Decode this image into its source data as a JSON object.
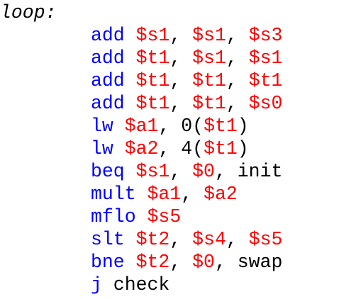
{
  "colors": {
    "mnemonic": "#0000ff",
    "register": "#ff0000",
    "text": "#000000",
    "background": "#ffffff"
  },
  "code": {
    "label": "loop:",
    "instructions": [
      {
        "tokens": [
          {
            "t": "op",
            "v": "add"
          },
          {
            "t": "txt",
            "v": " "
          },
          {
            "t": "reg",
            "v": "$s1"
          },
          {
            "t": "txt",
            "v": ", "
          },
          {
            "t": "reg",
            "v": "$s1"
          },
          {
            "t": "txt",
            "v": ", "
          },
          {
            "t": "reg",
            "v": "$s3"
          }
        ]
      },
      {
        "tokens": [
          {
            "t": "op",
            "v": "add"
          },
          {
            "t": "txt",
            "v": " "
          },
          {
            "t": "reg",
            "v": "$t1"
          },
          {
            "t": "txt",
            "v": ", "
          },
          {
            "t": "reg",
            "v": "$s1"
          },
          {
            "t": "txt",
            "v": ", "
          },
          {
            "t": "reg",
            "v": "$s1"
          }
        ]
      },
      {
        "tokens": [
          {
            "t": "op",
            "v": "add"
          },
          {
            "t": "txt",
            "v": " "
          },
          {
            "t": "reg",
            "v": "$t1"
          },
          {
            "t": "txt",
            "v": ", "
          },
          {
            "t": "reg",
            "v": "$t1"
          },
          {
            "t": "txt",
            "v": ", "
          },
          {
            "t": "reg",
            "v": "$t1"
          }
        ]
      },
      {
        "tokens": [
          {
            "t": "op",
            "v": "add"
          },
          {
            "t": "txt",
            "v": " "
          },
          {
            "t": "reg",
            "v": "$t1"
          },
          {
            "t": "txt",
            "v": ", "
          },
          {
            "t": "reg",
            "v": "$t1"
          },
          {
            "t": "txt",
            "v": ", "
          },
          {
            "t": "reg",
            "v": "$s0"
          }
        ]
      },
      {
        "tokens": [
          {
            "t": "op",
            "v": "lw"
          },
          {
            "t": "txt",
            "v": " "
          },
          {
            "t": "reg",
            "v": "$a1"
          },
          {
            "t": "txt",
            "v": ", 0("
          },
          {
            "t": "reg",
            "v": "$t1"
          },
          {
            "t": "txt",
            "v": ")"
          }
        ]
      },
      {
        "tokens": [
          {
            "t": "op",
            "v": "lw"
          },
          {
            "t": "txt",
            "v": " "
          },
          {
            "t": "reg",
            "v": "$a2"
          },
          {
            "t": "txt",
            "v": ", 4("
          },
          {
            "t": "reg",
            "v": "$t1"
          },
          {
            "t": "txt",
            "v": ")"
          }
        ]
      },
      {
        "tokens": [
          {
            "t": "op",
            "v": "beq"
          },
          {
            "t": "txt",
            "v": " "
          },
          {
            "t": "reg",
            "v": "$s1"
          },
          {
            "t": "txt",
            "v": ", "
          },
          {
            "t": "reg",
            "v": "$0"
          },
          {
            "t": "txt",
            "v": ", init"
          }
        ]
      },
      {
        "tokens": [
          {
            "t": "op",
            "v": "mult"
          },
          {
            "t": "txt",
            "v": " "
          },
          {
            "t": "reg",
            "v": "$a1"
          },
          {
            "t": "txt",
            "v": ", "
          },
          {
            "t": "reg",
            "v": "$a2"
          }
        ]
      },
      {
        "tokens": [
          {
            "t": "op",
            "v": "mflo"
          },
          {
            "t": "txt",
            "v": " "
          },
          {
            "t": "reg",
            "v": "$s5"
          }
        ]
      },
      {
        "tokens": [
          {
            "t": "op",
            "v": "slt"
          },
          {
            "t": "txt",
            "v": " "
          },
          {
            "t": "reg",
            "v": "$t2"
          },
          {
            "t": "txt",
            "v": ", "
          },
          {
            "t": "reg",
            "v": "$s4"
          },
          {
            "t": "txt",
            "v": ", "
          },
          {
            "t": "reg",
            "v": "$s5"
          }
        ]
      },
      {
        "tokens": [
          {
            "t": "op",
            "v": "bne"
          },
          {
            "t": "txt",
            "v": " "
          },
          {
            "t": "reg",
            "v": "$t2"
          },
          {
            "t": "txt",
            "v": ", "
          },
          {
            "t": "reg",
            "v": "$0"
          },
          {
            "t": "txt",
            "v": ", swap"
          }
        ]
      },
      {
        "tokens": [
          {
            "t": "op",
            "v": "j"
          },
          {
            "t": "txt",
            "v": " check"
          }
        ]
      }
    ]
  }
}
